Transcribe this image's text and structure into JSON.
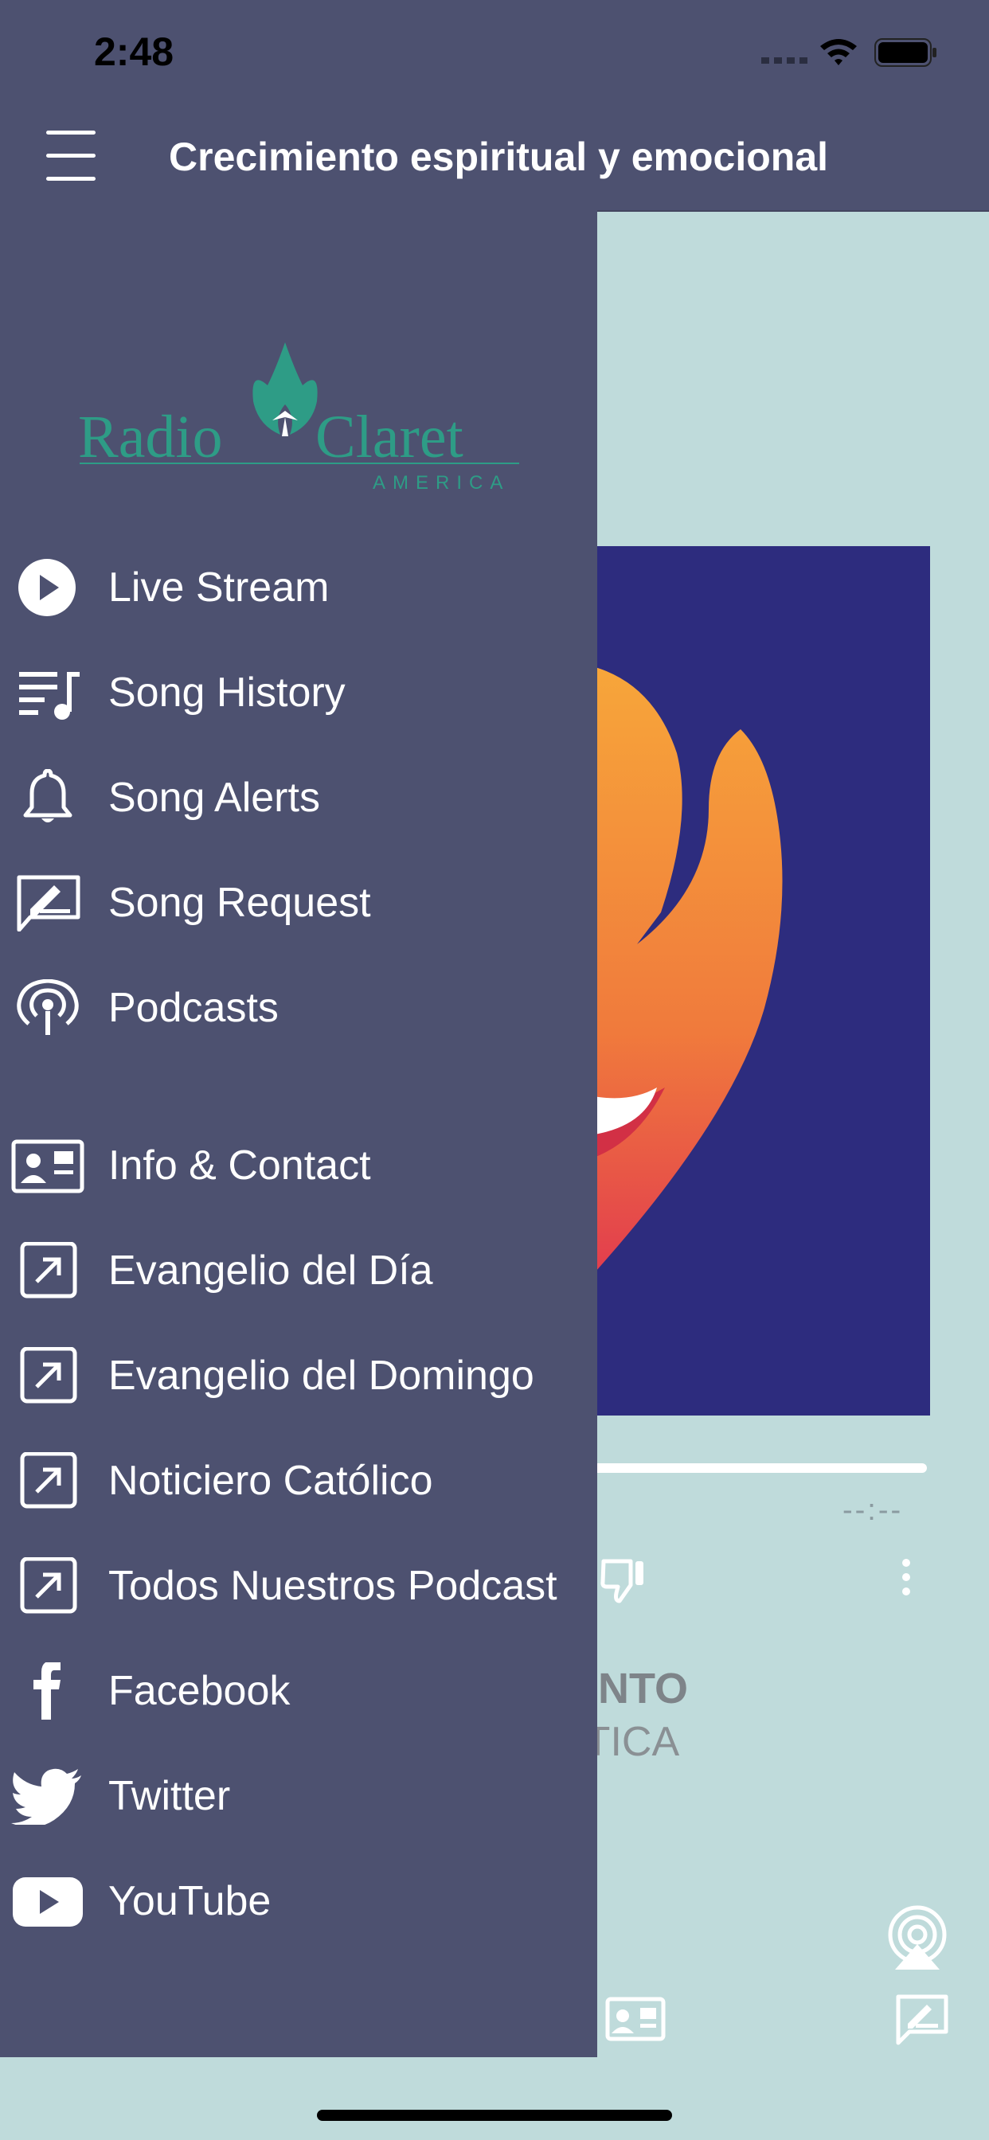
{
  "status_bar": {
    "time": "2:48"
  },
  "header": {
    "title": "Crecimiento espiritual y emocional"
  },
  "drawer": {
    "logo_text": "Radio Claret",
    "logo_subtext": "AMERICA",
    "items": [
      {
        "label": "Live Stream",
        "icon": "play-circle-icon"
      },
      {
        "label": "Song History",
        "icon": "music-list-icon"
      },
      {
        "label": "Song Alerts",
        "icon": "bell-icon"
      },
      {
        "label": "Song Request",
        "icon": "request-icon"
      },
      {
        "label": "Podcasts",
        "icon": "podcast-icon"
      },
      {
        "label": "Info & Contact",
        "icon": "contact-card-icon"
      },
      {
        "label": "Evangelio del Día",
        "icon": "external-link-icon"
      },
      {
        "label": "Evangelio del Domingo",
        "icon": "external-link-icon"
      },
      {
        "label": "Noticiero Católico",
        "icon": "external-link-icon"
      },
      {
        "label": "Todos Nuestros Podcast",
        "icon": "external-link-icon"
      },
      {
        "label": "Facebook",
        "icon": "facebook-icon"
      },
      {
        "label": "Twitter",
        "icon": "twitter-icon"
      },
      {
        "label": "YouTube",
        "icon": "youtube-icon"
      }
    ]
  },
  "player": {
    "time_remaining": "--:--",
    "track_title_visible": "IENTO",
    "track_artist_visible": "STICA",
    "progress": 1.0
  },
  "colors": {
    "drawer_bg": "#4d5170",
    "page_bg": "#bfdbdb",
    "album_bg": "#2d2c7e",
    "logo_green": "#2e9c86"
  }
}
